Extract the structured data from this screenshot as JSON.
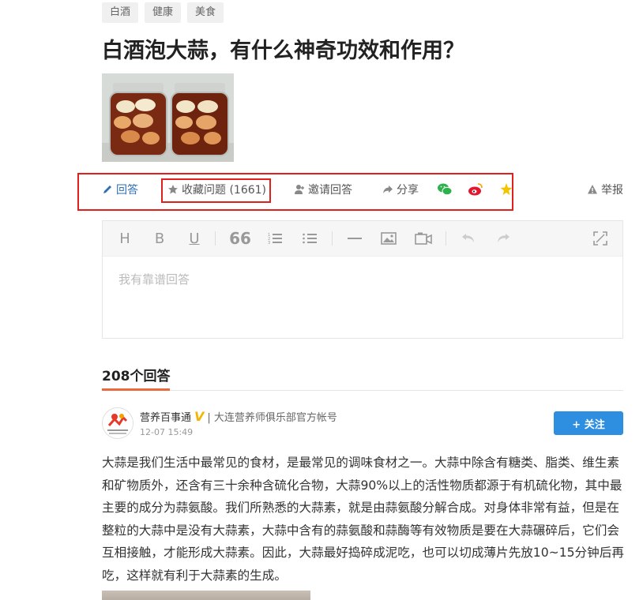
{
  "tags": [
    "白酒",
    "健康",
    "美食"
  ],
  "question": {
    "title": "白酒泡大蒜，有什么神奇功效和作用？"
  },
  "actions": {
    "answer": "回答",
    "favorite": "收藏问题 (1661)",
    "invite": "邀请回答",
    "share": "分享",
    "report": "举报"
  },
  "editor": {
    "placeholder": "我有靠谱回答",
    "tools": [
      "heading-icon",
      "bold-icon",
      "underline-icon",
      "quote-icon",
      "ordered-list-icon",
      "unordered-list-icon",
      "divider-icon",
      "image-icon",
      "video-icon",
      "undo-icon",
      "redo-icon",
      "fullscreen-icon"
    ]
  },
  "answers": {
    "count_label": "208个回答",
    "first": {
      "author": "营养百事通",
      "verified_badge": "V",
      "description": "| 大连营养师俱乐部官方帐号",
      "time": "12-07 15:49",
      "follow_label": "+ 关注",
      "text": "大蒜是我们生活中最常见的食材，是最常见的调味食材之一。大蒜中除含有糖类、脂类、维生素和矿物质外，还含有三十余种含硫化合物，大蒜90%以上的活性物质都源于有机硫化物，其中最主要的成分为蒜氨酸。我们所熟悉的大蒜素，就是由蒜氨酸分解合成。对身体非常有益，但是在整粒的大蒜中是没有大蒜素，大蒜中含有的蒜氨酸和蒜酶等有效物质是要在大蒜碾碎后，它们会互相接触，才能形成大蒜素。因此，大蒜最好捣碎成泥吃，也可以切成薄片先放10~15分钟后再吃，这样就有利于大蒜素的生成。"
    }
  },
  "colors": {
    "accent_blue": "#2e8ee0",
    "highlight_red": "#e0201a",
    "tab_underline": "#e96a3c",
    "wechat_green": "#2bb24c",
    "weibo_red": "#e6162d",
    "qzone_yellow": "#f5c400"
  }
}
